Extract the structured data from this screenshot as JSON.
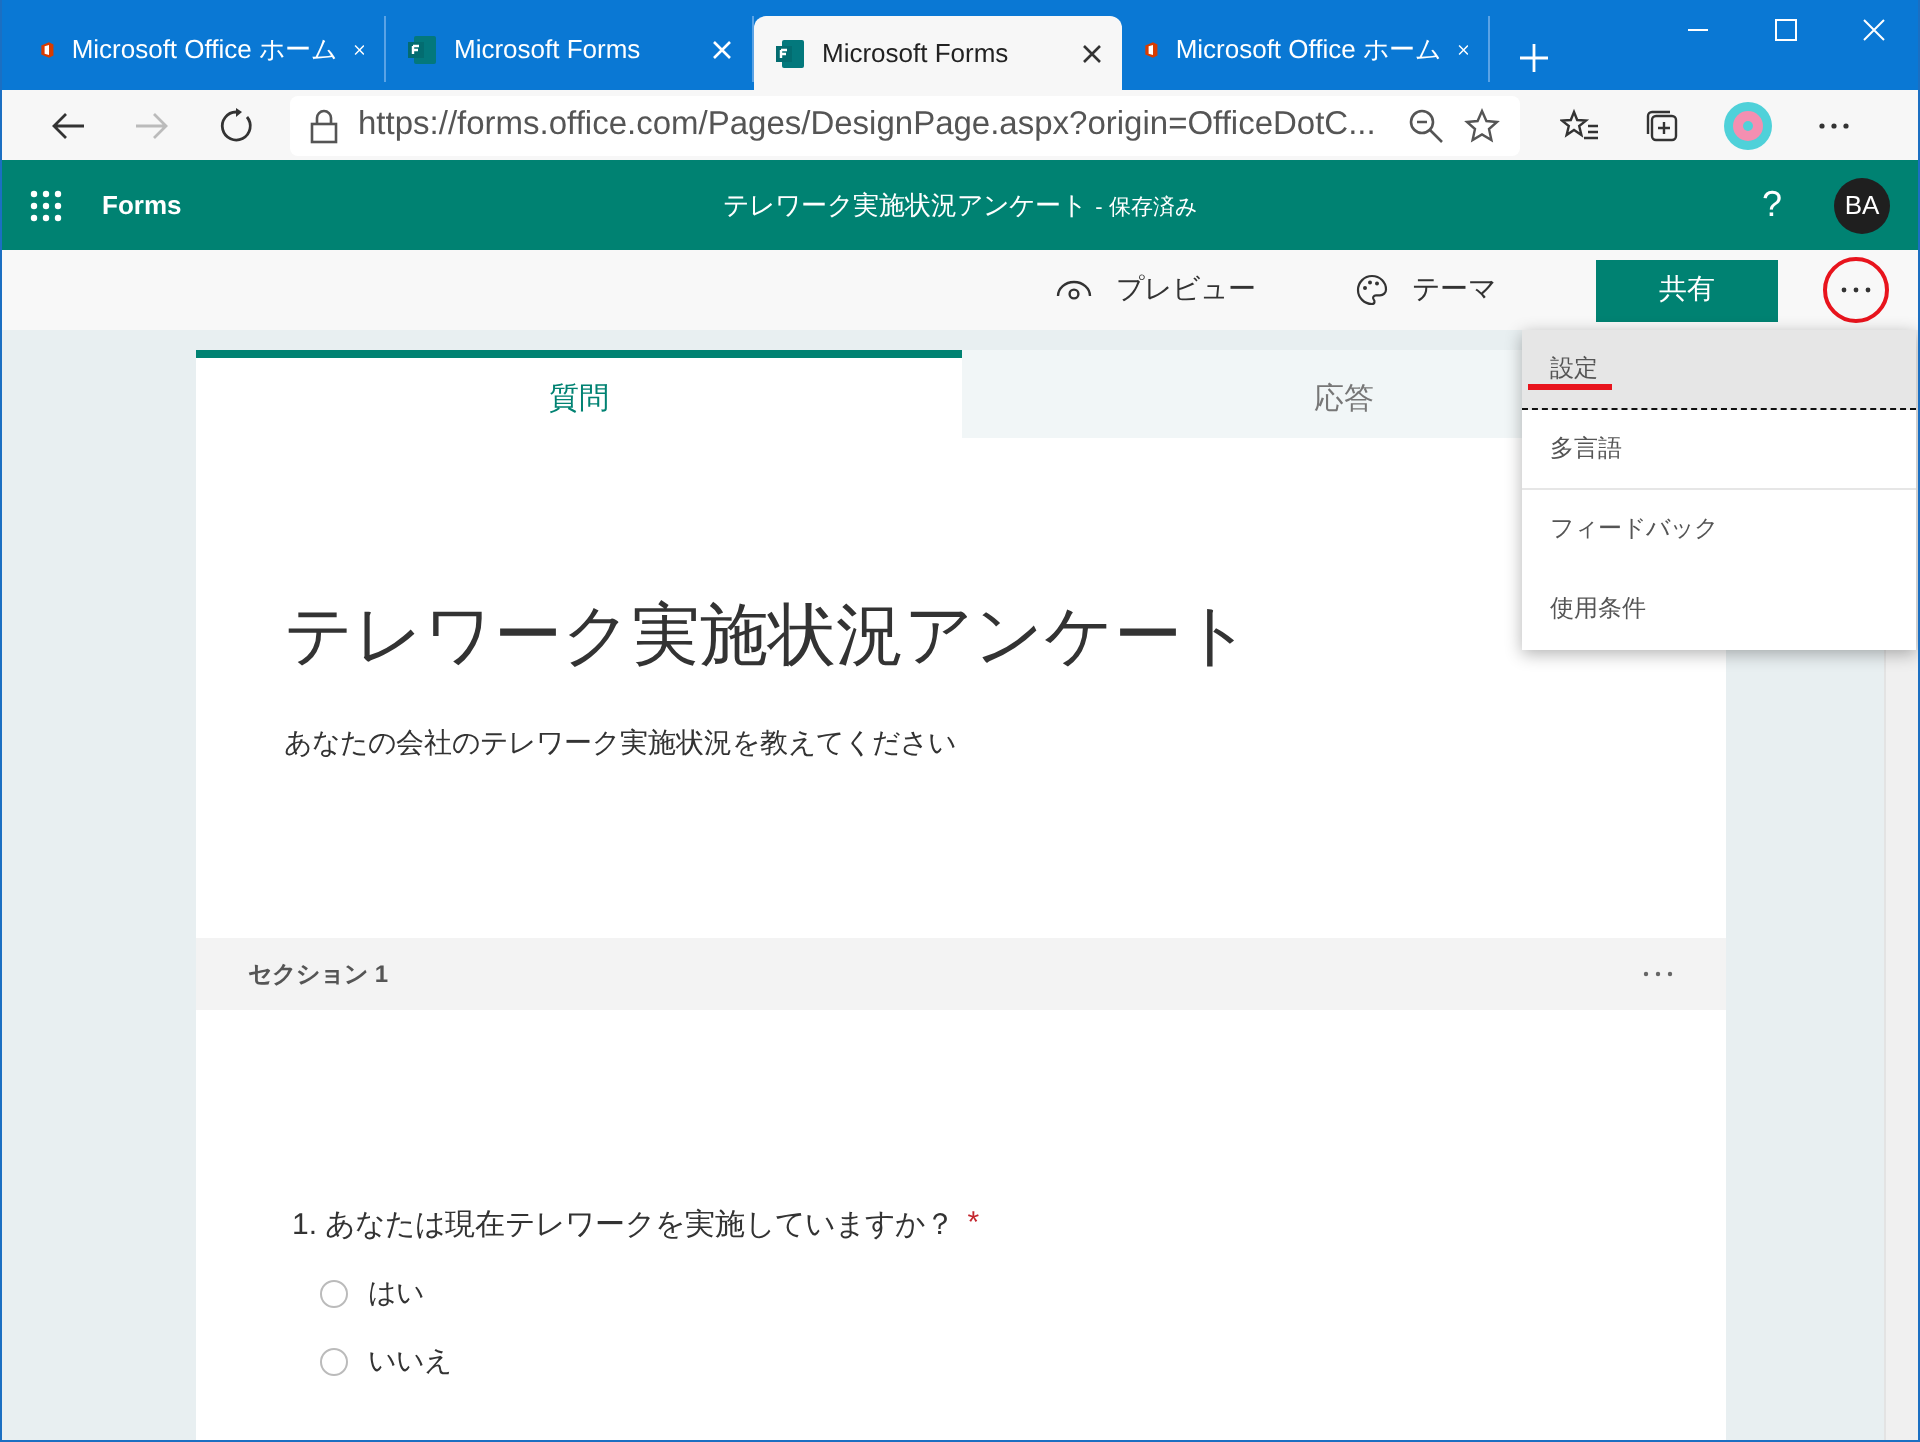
{
  "browser": {
    "tabs": [
      {
        "title": "Microsoft Office ホーム",
        "kind": "office",
        "selected": false
      },
      {
        "title": "Microsoft Forms",
        "kind": "forms",
        "selected": false
      },
      {
        "title": "Microsoft Forms",
        "kind": "forms",
        "selected": true
      },
      {
        "title": "Microsoft Office ホーム",
        "kind": "office",
        "selected": false
      }
    ],
    "url": "https://forms.office.com/Pages/DesignPage.aspx?origin=OfficeDotC..."
  },
  "app": {
    "name": "Forms",
    "form_title": "テレワーク実施状況アンケート",
    "save_status": "- 保存済み",
    "help": "?",
    "avatar": "BA"
  },
  "toolbar": {
    "preview": "プレビュー",
    "theme": "テーマ",
    "share": "共有",
    "more_circled": true
  },
  "menu": {
    "items": [
      {
        "label": "設定",
        "selected": true,
        "underlined": true
      },
      {
        "label": "多言語",
        "selected": false,
        "underlined": false
      },
      {
        "label": "フィードバック",
        "selected": false,
        "underlined": false
      },
      {
        "label": "使用条件",
        "selected": false,
        "underlined": false
      }
    ]
  },
  "form": {
    "tabs": [
      {
        "label": "質問",
        "selected": true
      },
      {
        "label": "応答",
        "selected": false
      }
    ],
    "title": "テレワーク実施状況アンケート",
    "description": "あなたの会社のテレワーク実施状況を教えてください",
    "section": {
      "label": "セクション 1"
    },
    "questions": [
      {
        "number": "1.",
        "text": "あなたは現在テレワークを実施していますか？",
        "required": true,
        "required_mark": "*",
        "options": [
          {
            "label": "はい",
            "selected": false
          },
          {
            "label": "いいえ",
            "selected": false
          }
        ]
      }
    ]
  }
}
